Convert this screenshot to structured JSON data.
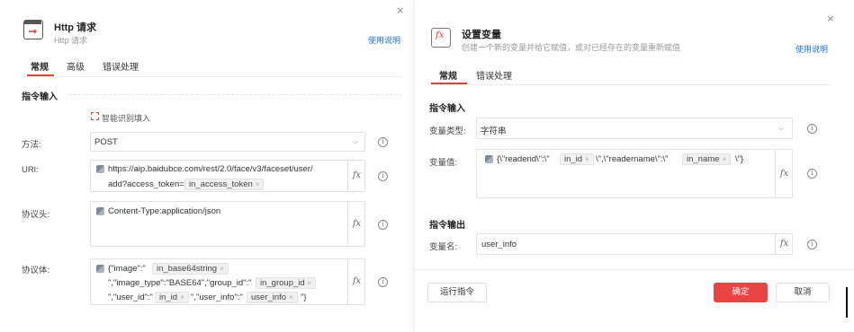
{
  "left": {
    "title": "Http 请求",
    "subtitle": "Http 请求",
    "help": "使用说明",
    "tabs": [
      {
        "label": "常规",
        "active": true
      },
      {
        "label": "高级",
        "active": false
      },
      {
        "label": "错误处理",
        "active": false
      }
    ],
    "section_input": "指令输入",
    "smart_fill": "智能识别填入",
    "method": {
      "label": "方法:",
      "value": "POST"
    },
    "url": {
      "label": "URl:",
      "line1": "https://aip.baidubce.com/rest/2.0/face/v3/faceset/user/",
      "line2_prefix": "add?access_token=",
      "chip": "in_access_token"
    },
    "headers": {
      "label": "协议头:",
      "value": "Content-Type:application/json"
    },
    "body": {
      "label": "协议体:",
      "l1_prefix": "{\"image\":\"",
      "l1_chip": "in_base64string",
      "l2_text": "\",\"image_type\":\"BASE64\",\"group_id\":\"",
      "l2_chip": "in_group_id",
      "l3_text1": "\",\"user_id\":\"",
      "l3_chip1": "in_id",
      "l3_text2": "\",\"user_info\":\"",
      "l3_chip2": "user_info",
      "l3_text3": "\"}"
    },
    "fx": "fx",
    "info": "i",
    "chip_x": "×",
    "close": "×"
  },
  "right": {
    "title": "设置变量",
    "subtitle": "创建一个新的变量并给它赋值，或对已经存在的变量重新赋值",
    "help": "使用说明",
    "tabs": [
      {
        "label": "常规",
        "active": true
      },
      {
        "label": "错误处理",
        "active": false
      }
    ],
    "section_input": "指令输入",
    "var_type": {
      "label": "变量类型:",
      "value": "字符串"
    },
    "var_value": {
      "label": "变量值:",
      "t1": "{\\\"readerid\\\":\\\"",
      "chip1": "in_id",
      "t2": "\\\",\\\"readername\\\":\\\"",
      "chip2": "in_name",
      "t3": "\\\"}"
    },
    "section_output": "指令输出",
    "var_name": {
      "label": "变量名:",
      "value": "user_info"
    },
    "run_button": "运行指令",
    "ok_button": "确定",
    "cancel_button": "取消",
    "fx": "fx",
    "info": "i",
    "chip_x": "×",
    "close": "×"
  },
  "colors": {
    "accent": "#e23b3b",
    "primary_button": "#e94444",
    "link": "#1976d2"
  },
  "icons": {
    "http": "http-request-icon",
    "variable": "fx-variable-icon",
    "python": "python-icon",
    "smart": "smart-fill-icon"
  }
}
